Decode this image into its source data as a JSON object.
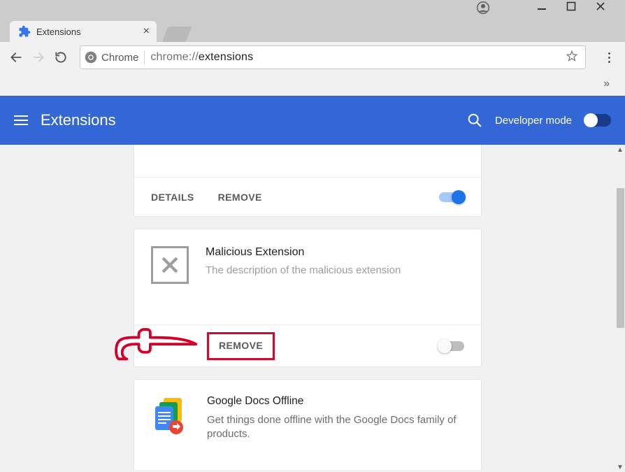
{
  "window": {
    "tab_title": "Extensions"
  },
  "toolbar": {
    "label": "Chrome",
    "url_prefix": "chrome://",
    "url_bold": "extensions",
    "overflow_symbol": "»"
  },
  "header": {
    "title": "Extensions",
    "dev_mode_label": "Developer mode"
  },
  "cards": {
    "c0": {
      "details": "DETAILS",
      "remove": "REMOVE"
    },
    "c1": {
      "title": "Malicious Extension",
      "desc": "The description of the malicious extension",
      "remove": "REMOVE"
    },
    "c2": {
      "title": "Google Docs Offline",
      "desc": "Get things done offline with the Google Docs family of products."
    }
  }
}
